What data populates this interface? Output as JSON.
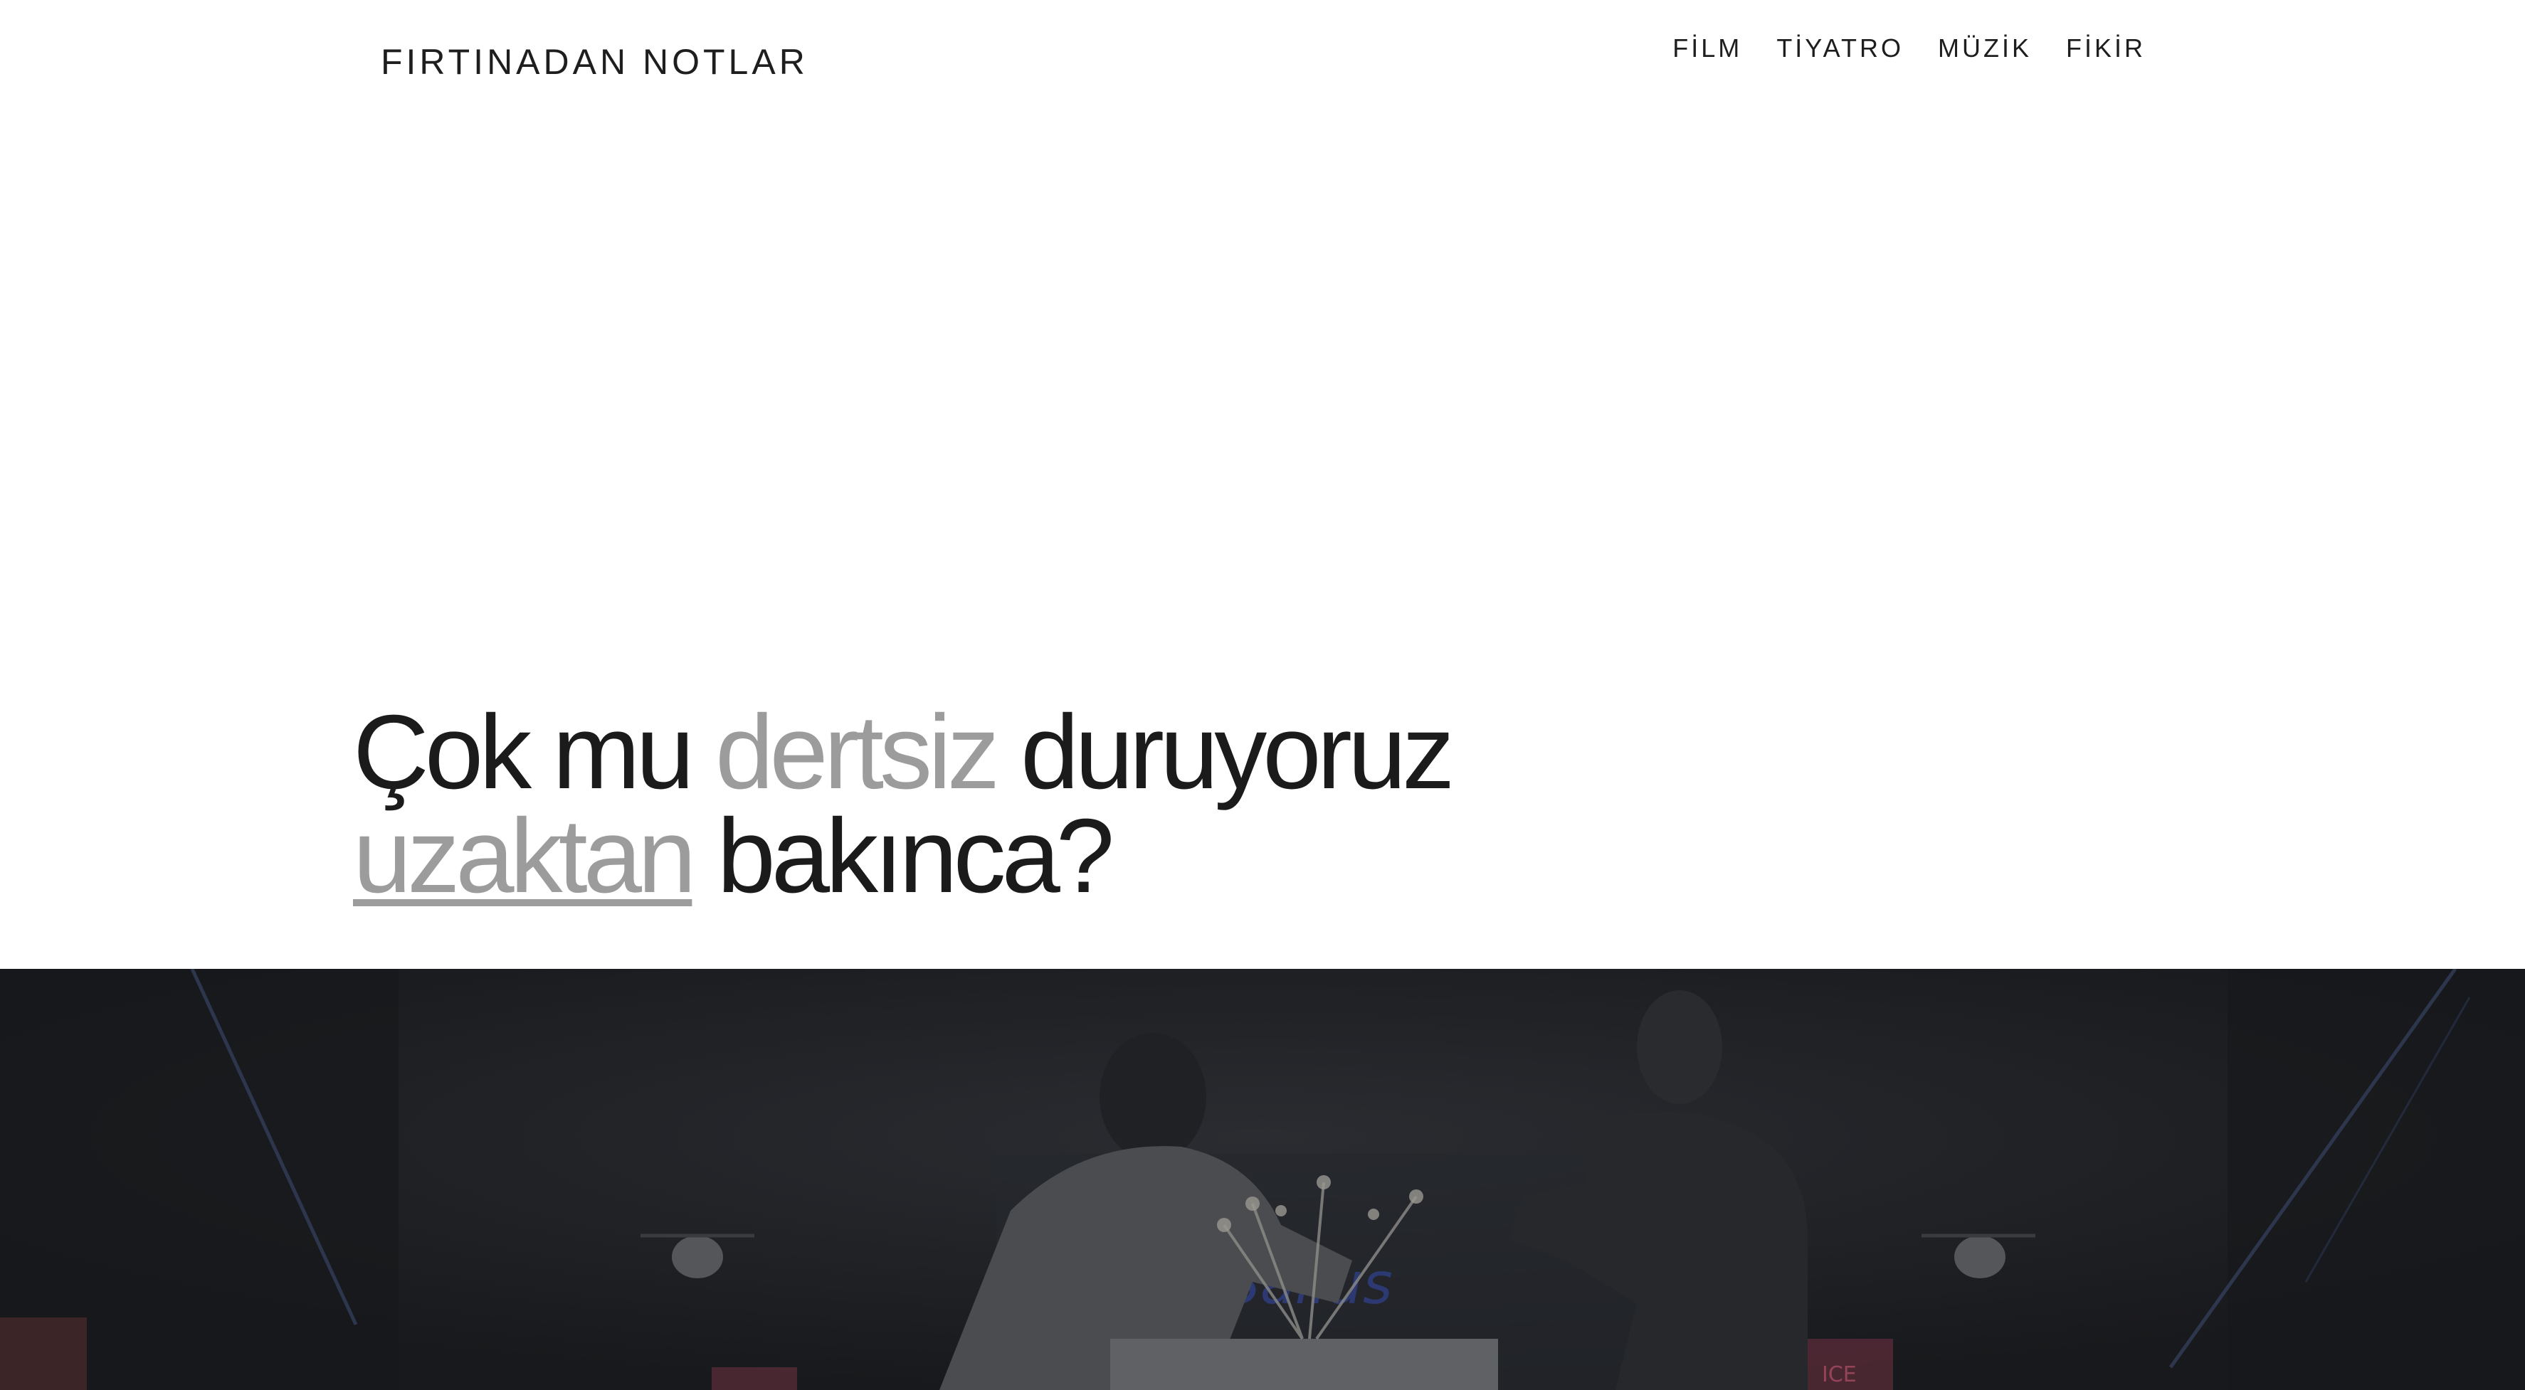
{
  "header": {
    "site_title": "FIRTINADAN NOTLAR",
    "nav": [
      {
        "label": "FİLM"
      },
      {
        "label": "TİYATRO"
      },
      {
        "label": "MÜZİK"
      },
      {
        "label": "FİKİR"
      }
    ]
  },
  "article": {
    "headline": {
      "part1": "Çok mu ",
      "part2": "dertsiz",
      "part3": " duruyoruz",
      "part4": "uzaktan",
      "part5": " bakınca?"
    }
  },
  "hero_image": {
    "description_icon": "stage-photo",
    "overlay_color": "#1b1c1f"
  }
}
